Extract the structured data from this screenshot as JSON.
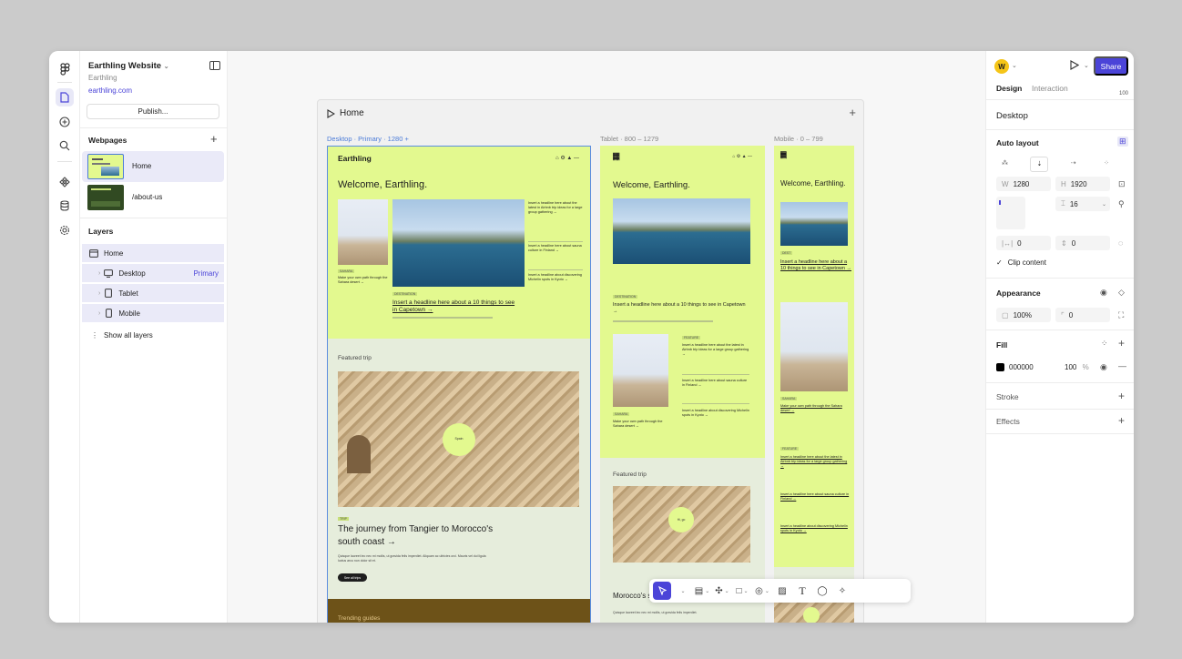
{
  "project": {
    "title": "Earthling Website",
    "subtitle": "Earthling",
    "url": "earthling.com",
    "publish_label": "Publish..."
  },
  "webpages": {
    "heading": "Webpages",
    "items": [
      {
        "label": "Home"
      },
      {
        "label": "/about-us"
      }
    ]
  },
  "layers": {
    "heading": "Layers",
    "items": [
      {
        "label": "Home"
      },
      {
        "label": "Desktop",
        "tag": "Primary"
      },
      {
        "label": "Tablet"
      },
      {
        "label": "Mobile"
      }
    ],
    "show_all": "Show all layers"
  },
  "canvas": {
    "frame_title": "Home",
    "breakpoints": {
      "desktop": "Desktop · Primary · 1280 +",
      "tablet": "Tablet · 800 – 1279",
      "mobile": "Mobile · 0 – 799"
    },
    "site": {
      "logo": "Earthling",
      "welcome": "Welcome, Earthling.",
      "hero_link": "Insert a headline here about a 10 things to see in Capetown →",
      "side_links": [
        "Insert a headline here about the latest in Airbnb trip ideas for a large group gathering →",
        "Insert a headline here about sauna culture in Finland →",
        "Insert a headline about discovering Michelin spots in Kyoto →"
      ],
      "desert_link": "Make your own path through the Sahara desert →",
      "featured_label": "Featured trip",
      "featured_title": "The journey from Tangier to Morocco's south coast →",
      "featured_body": "Quisque laoreet leo nec mi mollis, ut gravida felis imperdiet. Aliquam ac ultricies orci. Mauris vel dui ligula luctus arcu non dolor sit et.",
      "featured_button": "See all trips",
      "trending_label": "Trending guides",
      "circle_label": "Spain",
      "tablet_circle_label": "Hi, go",
      "tablet_hero_link": "Insert a headline here about a 10 things to see in Capetown →",
      "tablet_featured_snippet": "Morocco's south coast →",
      "tablet_featured_body": "Quisque laoreet leo nec mi mollis, ut gravida felis imperdiet.",
      "mobile_welcome": "Welcome, Earthling.",
      "mobile_hero_link": "Insert a headline here about a 10 things to see in Capetown →",
      "mobile_desert_link": "Make your own path through the Sahara desert →",
      "mobile_side_links": [
        "Insert a headline here about the latest in Airbnb trip ideas for a large group gathering →",
        "Insert a headline here about sauna culture in Finland →",
        "Insert a headline about discovering Michelin spots in Kyoto →"
      ]
    }
  },
  "inspector": {
    "avatar_letter": "W",
    "share_label": "Share",
    "tabs": [
      "Design",
      "Interaction"
    ],
    "zoom": "100",
    "frame_name": "Desktop",
    "auto_layout": {
      "heading": "Auto layout",
      "width_key": "W",
      "width": "1280",
      "height_key": "H",
      "height": "1920",
      "gap": "16",
      "padding_h": "0",
      "padding_v": "0",
      "clip_label": "Clip content"
    },
    "appearance": {
      "heading": "Appearance",
      "opacity": "100%",
      "radius": "0"
    },
    "fill": {
      "heading": "Fill",
      "hex": "000000",
      "opacity": "100",
      "unit": "%"
    },
    "stroke": {
      "heading": "Stroke"
    },
    "effects": {
      "heading": "Effects"
    }
  },
  "colors": {
    "accent": "#4b44d8",
    "lime": "#e3f98f",
    "avatar": "#f5c518"
  }
}
